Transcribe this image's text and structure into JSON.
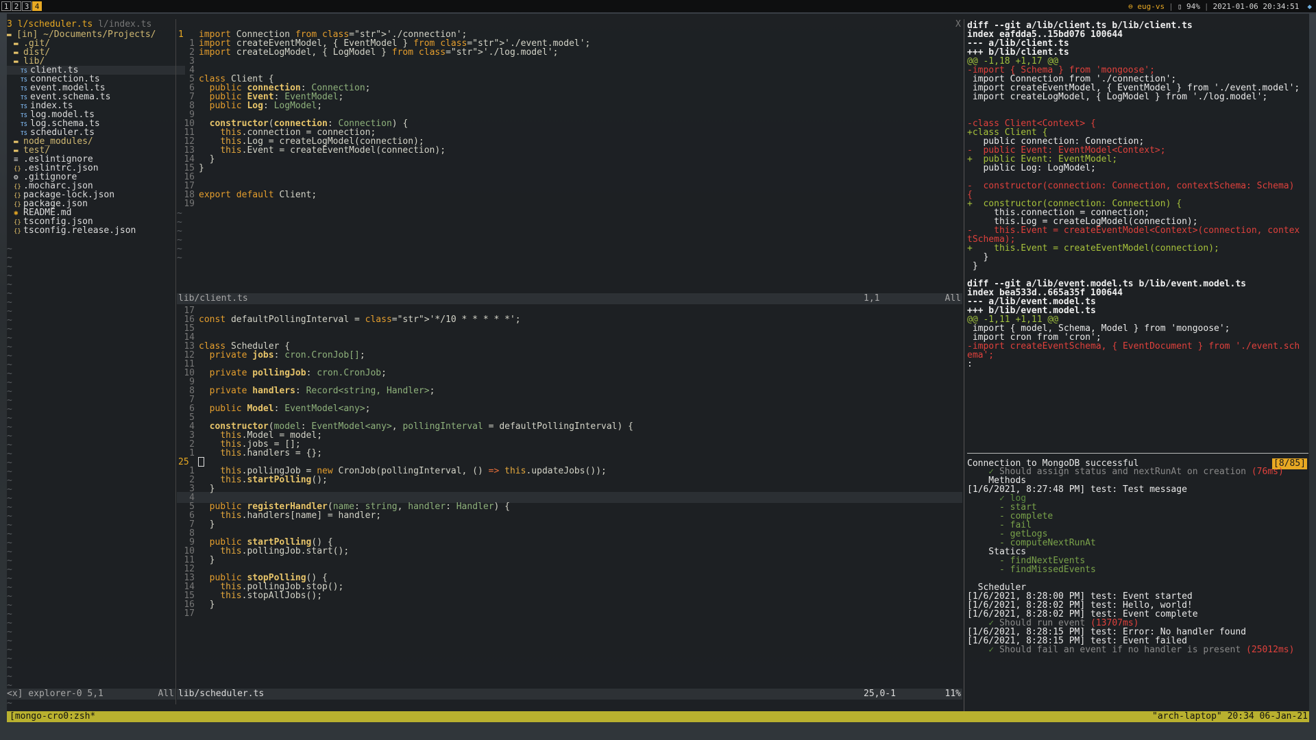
{
  "topbar": {
    "workspaces": [
      "1",
      "2",
      "3",
      "4"
    ],
    "active_workspace": "4",
    "host": "⊖ eug-vs",
    "battery": "▯ 94%",
    "datetime": "2021-01-06 20:34:51"
  },
  "tabline": {
    "count": "3",
    "active": "l/scheduler.ts",
    "inactive": "l/index.ts",
    "close": "X"
  },
  "explorer": {
    "root": "[in] ~/Documents/Projects/",
    "items": [
      {
        "label": ".git/",
        "kind": "dir"
      },
      {
        "label": "dist/",
        "kind": "dir"
      },
      {
        "label": "lib/",
        "kind": "dir-open"
      },
      {
        "label": "client.ts",
        "kind": "ts",
        "selected": true
      },
      {
        "label": "connection.ts",
        "kind": "ts"
      },
      {
        "label": "event.model.ts",
        "kind": "ts"
      },
      {
        "label": "event.schema.ts",
        "kind": "ts"
      },
      {
        "label": "index.ts",
        "kind": "ts"
      },
      {
        "label": "log.model.ts",
        "kind": "ts"
      },
      {
        "label": "log.schema.ts",
        "kind": "ts"
      },
      {
        "label": "scheduler.ts",
        "kind": "ts"
      },
      {
        "label": "node_modules/",
        "kind": "dir"
      },
      {
        "label": "test/",
        "kind": "dir"
      },
      {
        "label": ".eslintignore",
        "kind": "list"
      },
      {
        "label": ".eslintrc.json",
        "kind": "json"
      },
      {
        "label": ".gitignore",
        "kind": "gear"
      },
      {
        "label": ".mocharc.json",
        "kind": "json"
      },
      {
        "label": "package-lock.json",
        "kind": "json"
      },
      {
        "label": "package.json",
        "kind": "json"
      },
      {
        "label": "README.md",
        "kind": "md"
      },
      {
        "label": "tsconfig.json",
        "kind": "json"
      },
      {
        "label": "tsconfig.release.json",
        "kind": "json"
      }
    ],
    "status_left": "<x] explorer-0 5,1",
    "status_right": "All"
  },
  "editor_top": {
    "lines": [
      {
        "n": "1",
        "code": "import Connection from './connection';"
      },
      {
        "n": "1",
        "code": "import createEventModel, { EventModel } from './event.model';"
      },
      {
        "n": "2",
        "code": "import createLogModel, { LogModel } from './log.model';"
      },
      {
        "n": "3",
        "code": ""
      },
      {
        "n": "4",
        "code": ""
      },
      {
        "n": "5",
        "code": "class Client {"
      },
      {
        "n": "6",
        "code": "  public connection: Connection;"
      },
      {
        "n": "7",
        "code": "  public Event: EventModel;"
      },
      {
        "n": "8",
        "code": "  public Log: LogModel;"
      },
      {
        "n": "9",
        "code": ""
      },
      {
        "n": "10",
        "code": "  constructor(connection: Connection) {"
      },
      {
        "n": "11",
        "code": "    this.connection = connection;"
      },
      {
        "n": "12",
        "code": "    this.Log = createLogModel(connection);"
      },
      {
        "n": "13",
        "code": "    this.Event = createEventModel(connection);"
      },
      {
        "n": "14",
        "code": "  }"
      },
      {
        "n": "15",
        "code": "}"
      },
      {
        "n": "16",
        "code": ""
      },
      {
        "n": "17",
        "code": ""
      },
      {
        "n": "18",
        "code": "export default Client;"
      },
      {
        "n": "19",
        "code": ""
      }
    ],
    "status_file": "lib/client.ts",
    "status_pos": "1,1",
    "status_pct": "All"
  },
  "editor_bottom": {
    "lines": [
      {
        "n": "17",
        "code": ""
      },
      {
        "n": "16",
        "code": "const defaultPollingInterval = '*/10 * * * * *';"
      },
      {
        "n": "15",
        "code": ""
      },
      {
        "n": "14",
        "code": ""
      },
      {
        "n": "13",
        "code": "class Scheduler {"
      },
      {
        "n": "12",
        "code": "  private jobs: cron.CronJob[];"
      },
      {
        "n": "11",
        "code": ""
      },
      {
        "n": "10",
        "code": "  private pollingJob: cron.CronJob;"
      },
      {
        "n": "9",
        "code": ""
      },
      {
        "n": "8",
        "code": "  private handlers: Record<string, Handler>;"
      },
      {
        "n": "7",
        "code": ""
      },
      {
        "n": "6",
        "code": "  public Model: EventModel<any>;"
      },
      {
        "n": "5",
        "code": ""
      },
      {
        "n": "4",
        "code": "  constructor(model: EventModel<any>, pollingInterval = defaultPollingInterval) {"
      },
      {
        "n": "3",
        "code": "    this.Model = model;"
      },
      {
        "n": "2",
        "code": "    this.jobs = [];"
      },
      {
        "n": "1",
        "code": "    this.handlers = {};"
      },
      {
        "n": "25",
        "code": ""
      },
      {
        "n": "1",
        "code": "    this.pollingJob = new CronJob(pollingInterval, () => this.updateJobs());"
      },
      {
        "n": "2",
        "code": "    this.startPolling();"
      },
      {
        "n": "3",
        "code": "  }"
      },
      {
        "n": "4",
        "code": ""
      },
      {
        "n": "5",
        "code": "  public registerHandler(name: string, handler: Handler) {"
      },
      {
        "n": "6",
        "code": "    this.handlers[name] = handler;"
      },
      {
        "n": "7",
        "code": "  }"
      },
      {
        "n": "8",
        "code": ""
      },
      {
        "n": "9",
        "code": "  public startPolling() {"
      },
      {
        "n": "10",
        "code": "    this.pollingJob.start();"
      },
      {
        "n": "11",
        "code": "  }"
      },
      {
        "n": "12",
        "code": ""
      },
      {
        "n": "13",
        "code": "  public stopPolling() {"
      },
      {
        "n": "14",
        "code": "    this.pollingJob.stop();"
      },
      {
        "n": "15",
        "code": "    this.stopAllJobs();"
      },
      {
        "n": "16",
        "code": "  }"
      },
      {
        "n": "17",
        "code": ""
      }
    ],
    "status_file": "lib/scheduler.ts",
    "status_pos": "25,0-1",
    "status_pct": "11%"
  },
  "diff": {
    "lines": [
      {
        "t": "h",
        "text": "diff --git a/lib/client.ts b/lib/client.ts"
      },
      {
        "t": "h",
        "text": "index eafdda5..15bd076 100644"
      },
      {
        "t": "h",
        "text": "--- a/lib/client.ts"
      },
      {
        "t": "h",
        "text": "+++ b/lib/client.ts"
      },
      {
        "t": "c",
        "text": "@@ -1,18 +1,17 @@"
      },
      {
        "t": "m",
        "text": "-import { Schema } from 'mongoose';"
      },
      {
        "t": "n",
        "text": " import Connection from './connection';"
      },
      {
        "t": "n",
        "text": " import createEventModel, { EventModel } from './event.model';"
      },
      {
        "t": "n",
        "text": " import createLogModel, { LogModel } from './log.model';"
      },
      {
        "t": "n",
        "text": ""
      },
      {
        "t": "n",
        "text": ""
      },
      {
        "t": "m",
        "text": "-class Client<Context> {"
      },
      {
        "t": "p",
        "text": "+class Client {"
      },
      {
        "t": "n",
        "text": "   public connection: Connection;"
      },
      {
        "t": "m",
        "text": "-  public Event: EventModel<Context>;"
      },
      {
        "t": "p",
        "text": "+  public Event: EventModel;"
      },
      {
        "t": "n",
        "text": "   public Log: LogModel;"
      },
      {
        "t": "n",
        "text": ""
      },
      {
        "t": "m",
        "text": "-  constructor(connection: Connection, contextSchema: Schema)"
      },
      {
        "t": "m",
        "text": "{"
      },
      {
        "t": "p",
        "text": "+  constructor(connection: Connection) {"
      },
      {
        "t": "n",
        "text": "     this.connection = connection;"
      },
      {
        "t": "n",
        "text": "     this.Log = createLogModel(connection);"
      },
      {
        "t": "m",
        "text": "-    this.Event = createEventModel<Context>(connection, contex"
      },
      {
        "t": "m",
        "text": "tSchema);"
      },
      {
        "t": "p",
        "text": "+    this.Event = createEventModel(connection);"
      },
      {
        "t": "n",
        "text": "   }"
      },
      {
        "t": "n",
        "text": " }"
      },
      {
        "t": "n",
        "text": ""
      },
      {
        "t": "h",
        "text": "diff --git a/lib/event.model.ts b/lib/event.model.ts"
      },
      {
        "t": "h",
        "text": "index bea533d..665a35f 100644"
      },
      {
        "t": "h",
        "text": "--- a/lib/event.model.ts"
      },
      {
        "t": "h",
        "text": "+++ b/lib/event.model.ts"
      },
      {
        "t": "c",
        "text": "@@ -1,11 +1,11 @@"
      },
      {
        "t": "n",
        "text": " import { model, Schema, Model } from 'mongoose';"
      },
      {
        "t": "n",
        "text": " import cron from 'cron';"
      },
      {
        "t": "m",
        "text": "-import createEventSchema, { EventDocument } from './event.sch"
      },
      {
        "t": "m",
        "text": "ema';"
      },
      {
        "t": "n",
        "text": ":"
      }
    ]
  },
  "tests": {
    "header": "Connection to MongoDB successful",
    "badge": "[8/85]",
    "lines": [
      {
        "t": "ok",
        "text": "    ✓ Should assign status and nextRunAt on creation ",
        "ms": "(76ms)"
      },
      {
        "t": "n",
        "text": "    Methods"
      },
      {
        "t": "n",
        "text": "[1/6/2021, 8:27:48 PM] test: Test message"
      },
      {
        "t": "okd",
        "text": "      ✓ log"
      },
      {
        "t": "pend",
        "text": "      - start"
      },
      {
        "t": "pend",
        "text": "      - complete"
      },
      {
        "t": "pend",
        "text": "      - fail"
      },
      {
        "t": "pend",
        "text": "      - getLogs"
      },
      {
        "t": "pend",
        "text": "      - computeNextRunAt"
      },
      {
        "t": "n",
        "text": "    Statics"
      },
      {
        "t": "pend",
        "text": "      - findNextEvents"
      },
      {
        "t": "pend",
        "text": "      - findMissedEvents"
      },
      {
        "t": "n",
        "text": ""
      },
      {
        "t": "n",
        "text": "  Scheduler"
      },
      {
        "t": "n",
        "text": "[1/6/2021, 8:28:00 PM] test: Event started"
      },
      {
        "t": "n",
        "text": "[1/6/2021, 8:28:02 PM] test: Hello, world!"
      },
      {
        "t": "n",
        "text": "[1/6/2021, 8:28:02 PM] test: Event complete"
      },
      {
        "t": "ok",
        "text": "    ✓ Should run event ",
        "ms": "(13707ms)"
      },
      {
        "t": "n",
        "text": "[1/6/2021, 8:28:15 PM] test: Error: No handler found"
      },
      {
        "t": "n",
        "text": "[1/6/2021, 8:28:15 PM] test: Event failed"
      },
      {
        "t": "ok",
        "text": "    ✓ Should fail an event if no handler is present ",
        "ms": "(25012ms)"
      }
    ]
  },
  "tmux": {
    "left": "[mongo-cro0:zsh*",
    "right": "\"arch-laptop\" 20:34 06-Jan-21"
  }
}
